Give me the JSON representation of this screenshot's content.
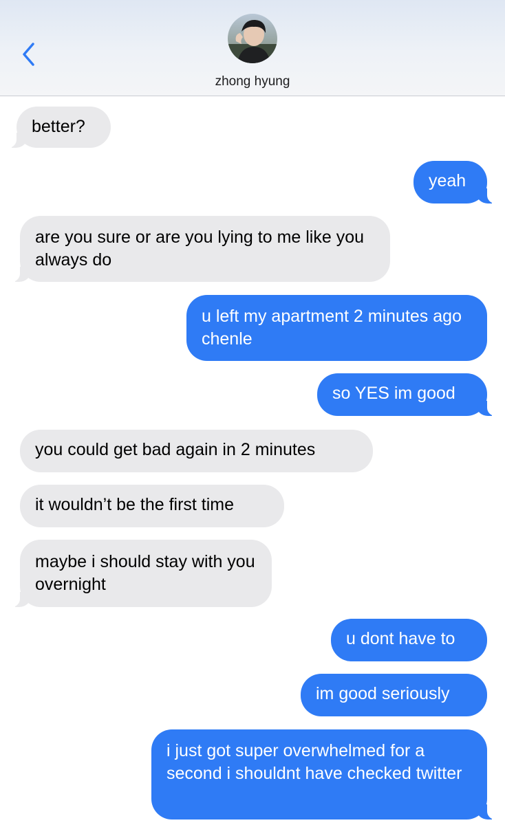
{
  "header": {
    "contact_name": "zhong hyung",
    "back_icon": "chevron-left-icon",
    "avatar_icon": "contact-avatar-photo",
    "accent_color": "#2f7bf5"
  },
  "colors": {
    "incoming_bubble": "#e9e9eb",
    "outgoing_bubble": "#2f7bf5"
  },
  "messages": [
    {
      "sender": "them",
      "text": "better?"
    },
    {
      "sender": "me",
      "text": "yeah"
    },
    {
      "sender": "them",
      "text": "are you sure or are you lying to me like you always do"
    },
    {
      "sender": "me",
      "text": "u left my apartment 2 minutes ago chenle"
    },
    {
      "sender": "me",
      "text": "so YES im good"
    },
    {
      "sender": "them",
      "text": "you could get bad again in 2 minutes"
    },
    {
      "sender": "them",
      "text": "it wouldn’t be the first time"
    },
    {
      "sender": "them",
      "text": "maybe i should stay with you overnight"
    },
    {
      "sender": "me",
      "text": "u dont have to"
    },
    {
      "sender": "me",
      "text": "im good seriously"
    },
    {
      "sender": "me",
      "text": "i just got super overwhelmed for a second i shouldnt have checked twitter"
    }
  ]
}
